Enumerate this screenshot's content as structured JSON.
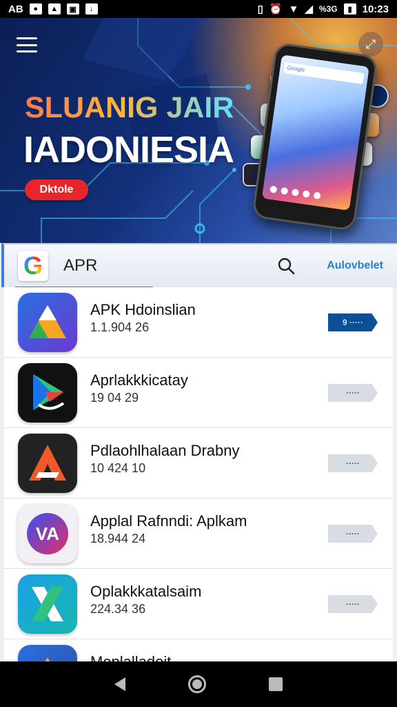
{
  "status_bar": {
    "left_text": "AB",
    "left_icons": [
      "notification-icon",
      "image-icon",
      "gallery-icon",
      "download-icon"
    ],
    "right_icons": [
      "vibrate-icon",
      "alarm-icon",
      "wifi-icon",
      "signal-icon"
    ],
    "network_text": "%3G",
    "time": "10:23"
  },
  "banner": {
    "title_line1": "SLUANIG JAIR",
    "title_line2": "IADONIESIA",
    "button_label": "Dktole",
    "phone_search_text": "Google"
  },
  "search": {
    "value": "APR",
    "action_label": "Aulovbelet",
    "logo_letter": "G"
  },
  "apps": [
    {
      "title": "APK Hdoinslian",
      "subtitle": "1.1.904 26",
      "button_label": "9 ·····",
      "icon": "drive-triangle-icon"
    },
    {
      "title": "Aprlakkkicatay",
      "subtitle": "19 04 29",
      "button_label": "·····",
      "icon": "play-store-icon"
    },
    {
      "title": "Pdlaohlhalaan Drabny",
      "subtitle": "10 424 10",
      "button_label": "·····",
      "icon": "red-a-icon"
    },
    {
      "title": "Applal Rafnndi: Aplkam",
      "subtitle": "18.944 24",
      "button_label": "·····",
      "icon": "va-logo-icon"
    },
    {
      "title": "Oplakkkatalsaim",
      "subtitle": "224.34 36",
      "button_label": "·····",
      "icon": "excel-x-icon"
    },
    {
      "title": "Moplalladoit",
      "subtitle": "",
      "button_label": "·····",
      "icon": "drive-triangle-icon"
    }
  ],
  "colors": {
    "accent": "#3b7fd8",
    "primary_button": "#0d4f96",
    "banner_cta": "#e8262a"
  }
}
